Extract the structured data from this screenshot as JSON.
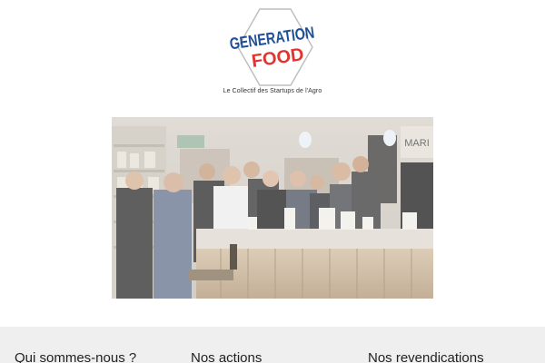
{
  "brand": {
    "logo_line1": "GENERATION",
    "logo_line2": "FOOD",
    "tagline": "Le Collectif des Startups de l'Agro",
    "colors": {
      "blue": "#1f4f96",
      "red": "#e2342f",
      "diamond": "#b9b9b9"
    }
  },
  "hero": {
    "shop_sign": "MARI"
  },
  "footer": {
    "columns": [
      {
        "title": "Qui sommes-nous ?"
      },
      {
        "title": "Nos actions"
      },
      {
        "title": "Nos revendications"
      }
    ]
  }
}
